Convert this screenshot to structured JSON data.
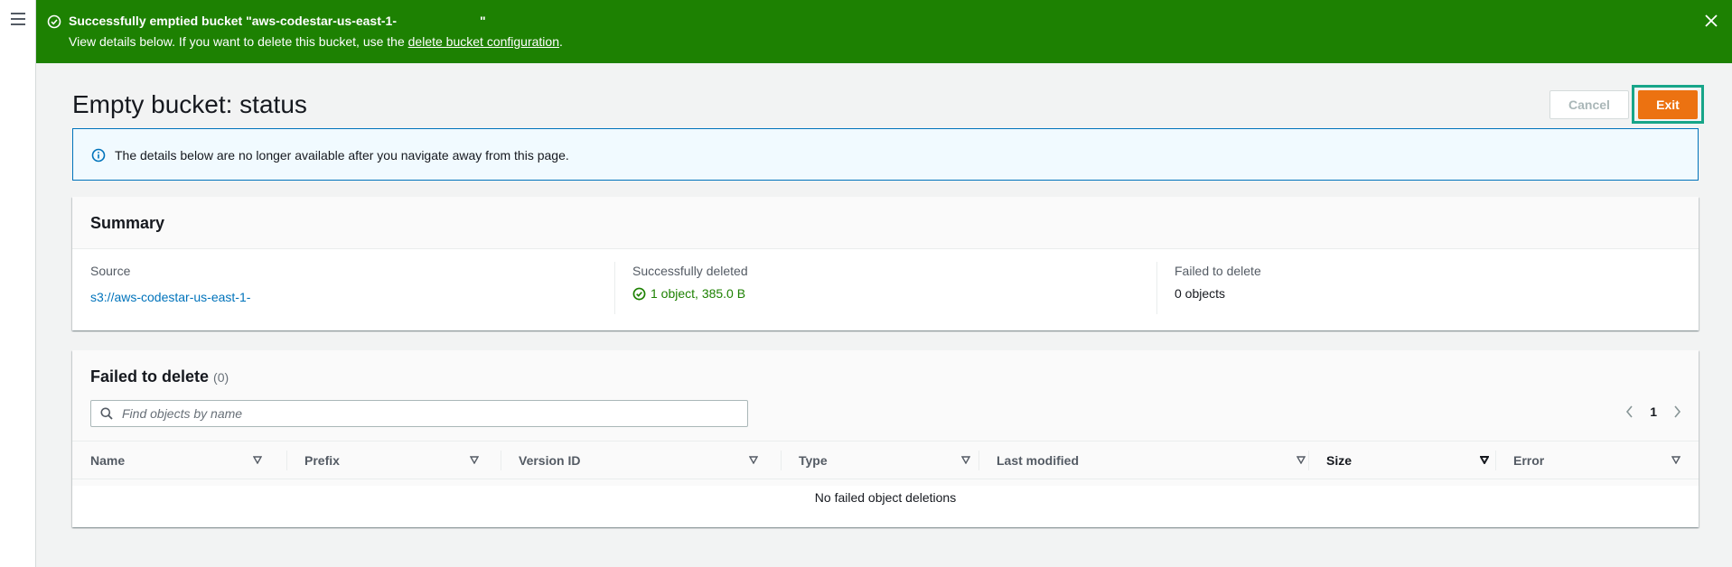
{
  "flash": {
    "title": "Successfully emptied bucket \"aws-codestar-us-east-1-",
    "title_end": "\"",
    "detail_prefix": "View details below. If you want to delete this bucket, use the ",
    "detail_link": "delete bucket configuration",
    "detail_suffix": ".",
    "color": "#1d8102"
  },
  "header": {
    "title": "Empty bucket: status",
    "cancel_label": "Cancel",
    "exit_label": "Exit",
    "annotation": "1"
  },
  "alert": {
    "message": "The details below are no longer available after you navigate away from this page."
  },
  "summary": {
    "heading": "Summary",
    "source_label": "Source",
    "source_value": "s3://aws-codestar-us-east-1-",
    "deleted_label": "Successfully deleted",
    "deleted_value": "1 object, 385.0 B",
    "failed_label": "Failed to delete",
    "failed_value": "0 objects"
  },
  "failed_table": {
    "heading": "Failed to delete",
    "count": "(0)",
    "search_placeholder": "Find objects by name",
    "page": "1",
    "columns": [
      "Name",
      "Prefix",
      "Version ID",
      "Type",
      "Last modified",
      "Size",
      "Error"
    ],
    "empty_message": "No failed object deletions"
  },
  "colors": {
    "accent": "#ec7211",
    "link": "#0073bb",
    "success": "#1d8102",
    "annotation": "#17a589"
  }
}
